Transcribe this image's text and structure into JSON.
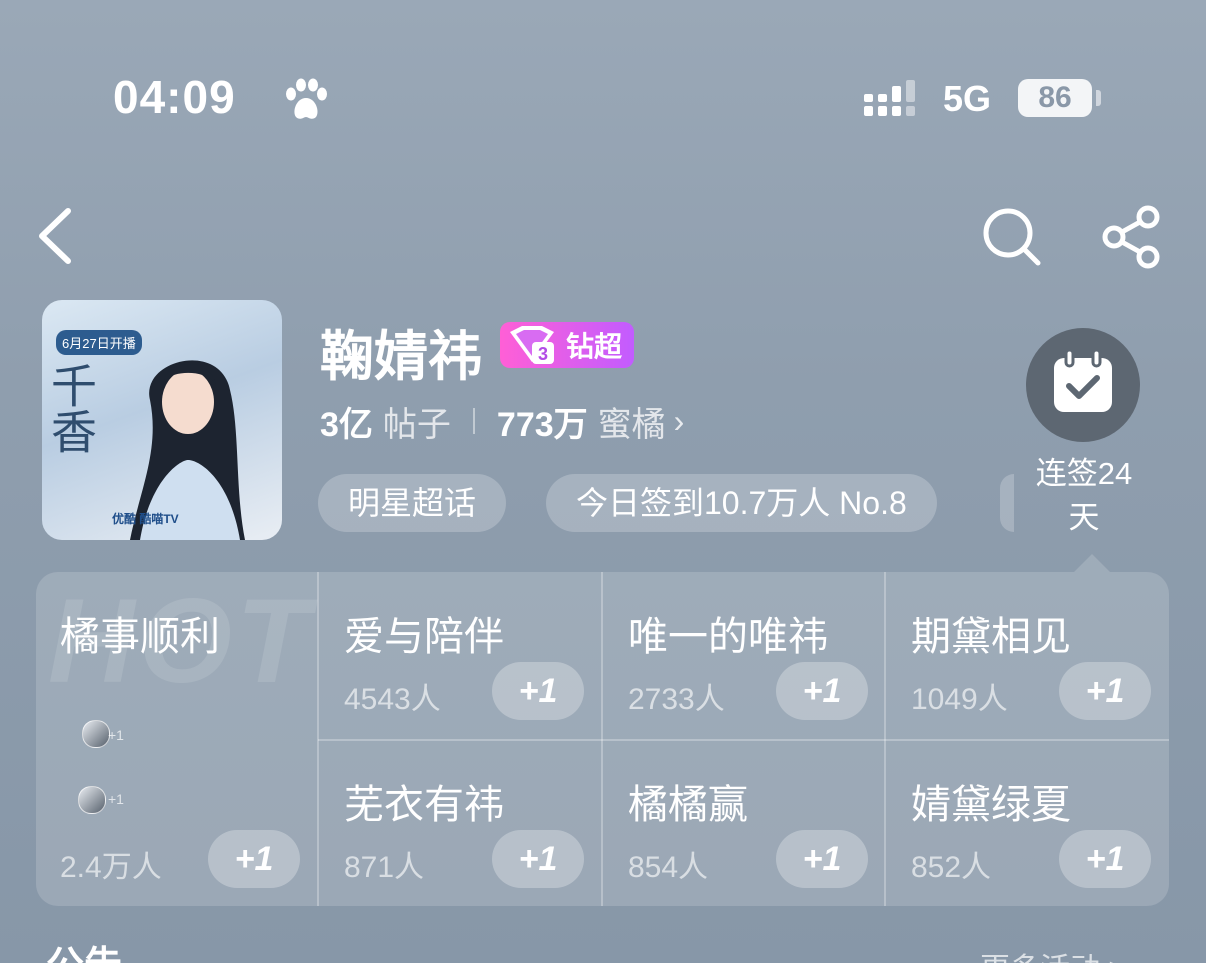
{
  "status_bar": {
    "time": "04:09",
    "network": "5G",
    "battery": "86"
  },
  "nav": {
    "back_icon": "back-icon",
    "search_icon": "search-icon",
    "share_icon": "share-icon"
  },
  "header": {
    "title": "鞠婧祎",
    "vip_level": "3",
    "vip_label": "钻超",
    "posts_count": "3亿",
    "posts_label": "帖子",
    "fans_count": "773万",
    "fans_label": "蜜橘",
    "tags": [
      "明星超话",
      "今日签到10.7万人 No.8"
    ],
    "checkin_label_line1": "连签24",
    "checkin_label_line2": "天",
    "cover": {
      "badge": "6月27日开播",
      "calligraphy": "千香",
      "logos": "优酷  酷喵TV"
    }
  },
  "panel": {
    "watermark": "HOT",
    "featured": {
      "title": "橘事顺利",
      "count": "2.4万人",
      "plus": "+1",
      "mini_plus": "+1"
    },
    "cells": [
      {
        "title": "爱与陪伴",
        "count": "4543人",
        "plus": "+1"
      },
      {
        "title": "唯一的唯祎",
        "count": "2733人",
        "plus": "+1"
      },
      {
        "title": "期黛相见",
        "count": "1049人",
        "plus": "+1"
      },
      {
        "title": "芜衣有祎",
        "count": "871人",
        "plus": "+1"
      },
      {
        "title": "橘橘赢",
        "count": "854人",
        "plus": "+1"
      },
      {
        "title": "婧黛绿夏",
        "count": "852人",
        "plus": "+1"
      }
    ]
  },
  "bottom": {
    "left": "公告",
    "right": "更多活动 >"
  },
  "colors": {
    "vip_start": "#ff5fd6",
    "vip_end": "#c25cff",
    "checkin_bg": "#5d6772"
  }
}
